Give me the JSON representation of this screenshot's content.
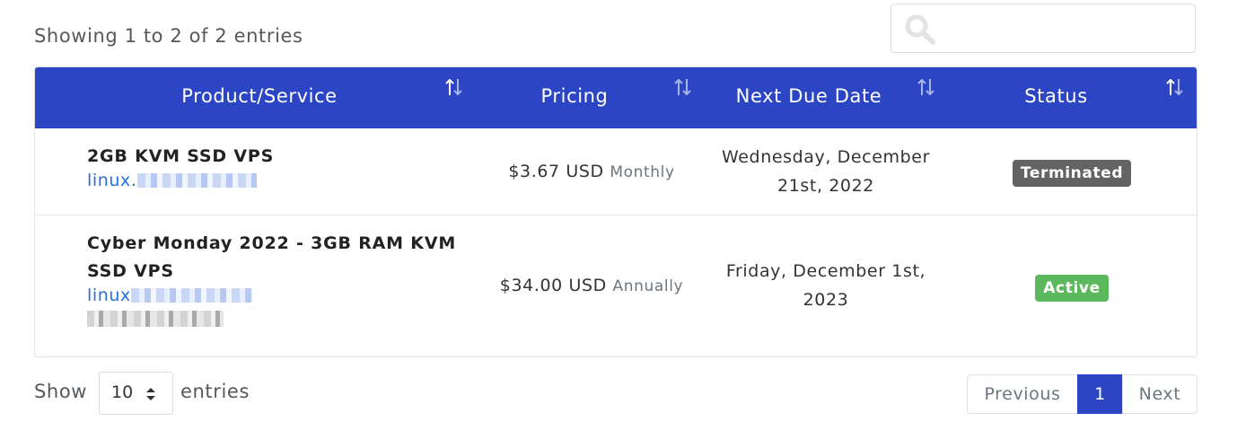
{
  "info_text": "Showing 1 to 2 of 2 entries",
  "search": {
    "placeholder": "",
    "value": ""
  },
  "table": {
    "headers": [
      "Product/Service",
      "Pricing",
      "Next Due Date",
      "Status"
    ],
    "rows": [
      {
        "product": "2GB KVM SSD VPS",
        "domain_visible": "linux.",
        "amount": "$3.67 USD",
        "cycle": "Monthly",
        "due_line1": "Wednesday, December",
        "due_line2": "21st, 2022",
        "status": "Terminated",
        "status_color": "#636363"
      },
      {
        "product_line1": "Cyber Monday 2022 - 3GB RAM KVM",
        "product_line2": "SSD VPS",
        "domain_visible": "linux",
        "amount": "$34.00 USD",
        "cycle": "Annually",
        "due_line1": "Friday, December 1st,",
        "due_line2": "2023",
        "status": "Active",
        "status_color": "#5cb85c"
      }
    ]
  },
  "footer": {
    "show_label": "Show",
    "page_size": "10",
    "entries_label": "entries",
    "previous": "Previous",
    "current_page": "1",
    "next": "Next"
  },
  "colors": {
    "header_bg": "#2c45c5",
    "link": "#2a6ed8",
    "active_page": "#2c45c5"
  }
}
